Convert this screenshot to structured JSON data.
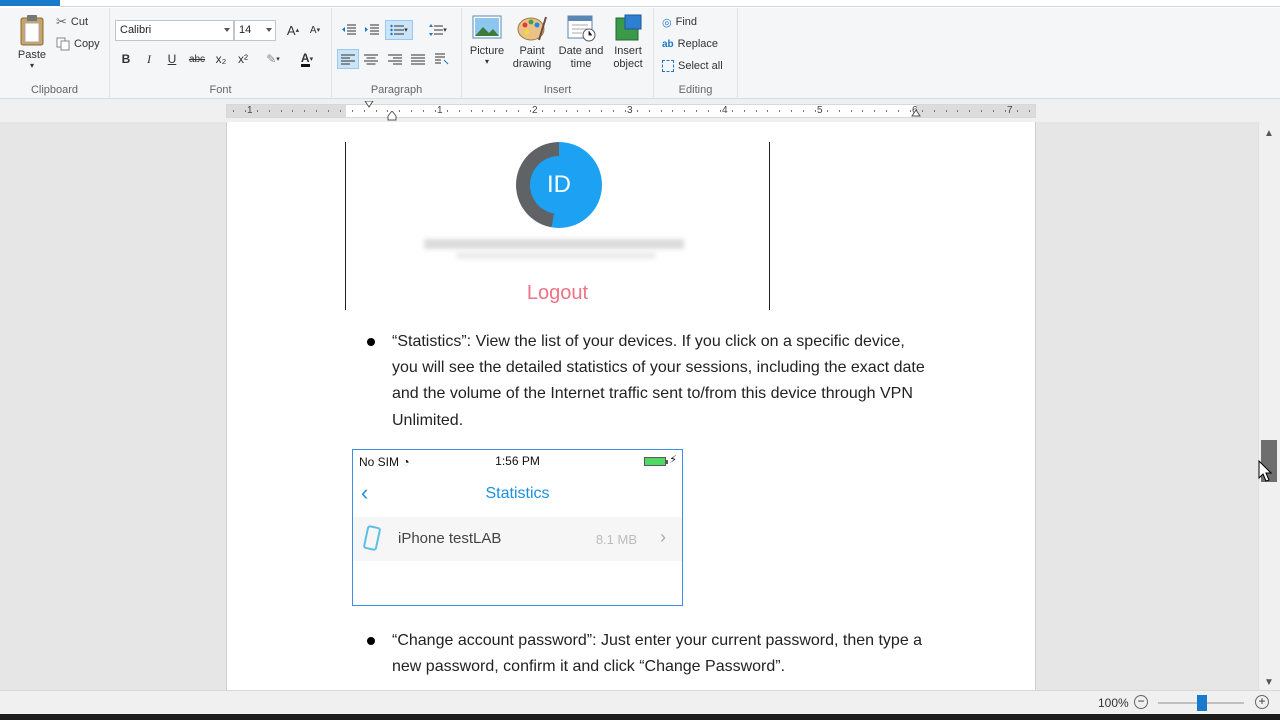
{
  "ribbon": {
    "clipboard": {
      "paste": "Paste",
      "cut": "Cut",
      "copy": "Copy",
      "label": "Clipboard"
    },
    "font": {
      "family": "Calibri",
      "size": "14",
      "label": "Font",
      "bold": "B",
      "italic": "I",
      "underline": "U",
      "strike": "abc",
      "subscript": "x₂",
      "superscript": "x²",
      "color_letter": "A",
      "grow": "A",
      "shrink": "A"
    },
    "paragraph": {
      "label": "Paragraph"
    },
    "insert": {
      "picture": "Picture",
      "paint1": "Paint",
      "paint2": "drawing",
      "date1": "Date and",
      "date2": "time",
      "obj1": "Insert",
      "obj2": "object",
      "label": "Insert"
    },
    "editing": {
      "find": "Find",
      "replace": "Replace",
      "select_all": "Select all",
      "label": "Editing"
    }
  },
  "ruler": {
    "numbers": [
      "1",
      "1",
      "2",
      "3",
      "4",
      "5",
      "6",
      "7"
    ]
  },
  "document": {
    "id_text": "ID",
    "logout": "Logout",
    "bullet1": "“Statistics”: View the list of your devices. If you click on a specific device, you will see the detailed statistics of your sessions, including the exact date and the volume of the Internet traffic sent to/from this device through VPN Unlimited.",
    "bullet2": "“Change account password”: Just enter your current password, then type a new password, confirm it and click “Change Password”.",
    "phone": {
      "carrier": "No SIM",
      "time": "1:56 PM",
      "title": "Statistics",
      "device": "iPhone testLAB",
      "size": "8.1 MB"
    }
  },
  "statusbar": {
    "zoom": "100%"
  },
  "colors": {
    "accent": "#1979ca",
    "ios_blue": "#1d8fe1",
    "logout_pink": "#ee7387"
  }
}
